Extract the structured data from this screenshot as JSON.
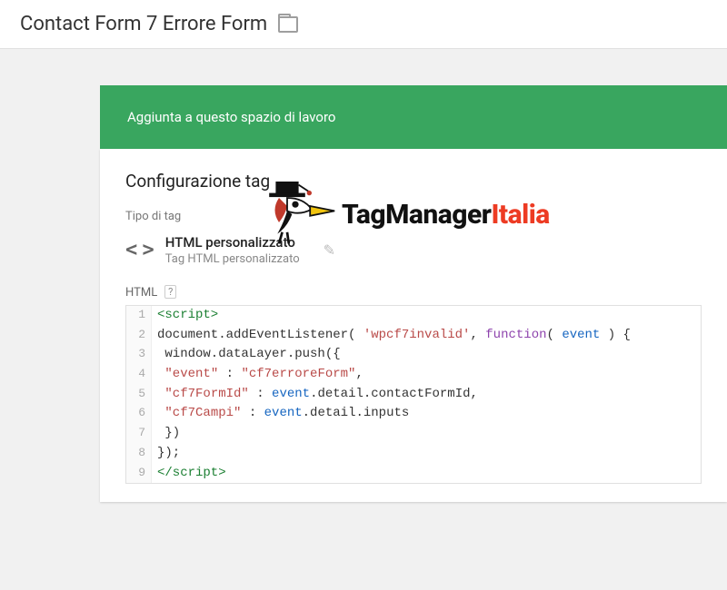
{
  "header": {
    "title": "Contact Form 7 Errore Form"
  },
  "banner": {
    "text": "Aggiunta a questo spazio di lavoro"
  },
  "card": {
    "title": "Configurazione tag",
    "tag_type_label": "Tipo di tag",
    "tag_type_name": "HTML personalizzato",
    "tag_type_desc": "Tag HTML personalizzato",
    "html_label": "HTML",
    "help_badge": "?"
  },
  "watermark": {
    "brand_a": "TagManager",
    "brand_b": "Italia"
  },
  "code": {
    "lines": {
      "1": "<script>",
      "2a": "document.addEventListener( ",
      "2b": "'wpcf7invalid'",
      "2c": ", ",
      "2d": "function",
      "2e": "( ",
      "2f": "event",
      "2g": " ) {",
      "3": " window.dataLayer.push({",
      "4a": " ",
      "4b": "\"event\"",
      "4c": " : ",
      "4d": "\"cf7erroreForm\"",
      "4e": ",",
      "5a": " ",
      "5b": "\"cf7FormId\"",
      "5c": " : ",
      "5d": "event",
      "5e": ".detail.contactFormId,",
      "6a": " ",
      "6b": "\"cf7Campi\"",
      "6c": " : ",
      "6d": "event",
      "6e": ".detail.inputs",
      "7": " })",
      "8": "});",
      "9": "</script>"
    }
  }
}
